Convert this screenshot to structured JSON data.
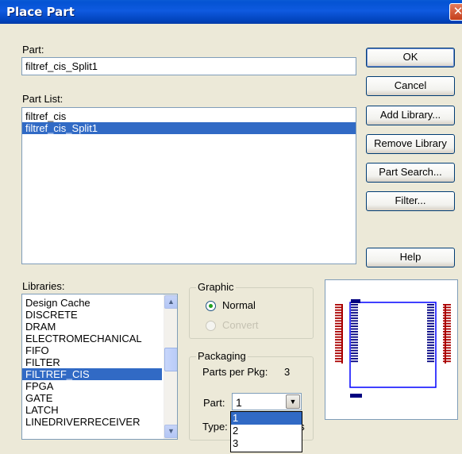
{
  "window": {
    "title": "Place Part",
    "close_glyph": "✕"
  },
  "part": {
    "label": "Part:",
    "value": "filtref_cis_Split1"
  },
  "part_list": {
    "label": "Part List:",
    "items": [
      "filtref_cis",
      "filtref_cis_Split1"
    ],
    "selected_index": 1
  },
  "buttons": {
    "ok": "OK",
    "cancel": "Cancel",
    "add_library": "Add Library...",
    "remove_library": "Remove Library",
    "part_search": "Part Search...",
    "filter": "Filter...",
    "help": "Help"
  },
  "libraries": {
    "label": "Libraries:",
    "items": [
      "Design Cache",
      "DISCRETE",
      "DRAM",
      "ELECTROMECHANICAL",
      "FIFO",
      "FILTER",
      "FILTREF_CIS",
      "FPGA",
      "GATE",
      "LATCH",
      "LINEDRIVERRECEIVER"
    ],
    "selected_index": 6
  },
  "graphic": {
    "title": "Graphic",
    "normal": "Normal",
    "convert": "Convert"
  },
  "packaging": {
    "title": "Packaging",
    "parts_per_pkg_label": "Parts per Pkg:",
    "parts_per_pkg_value": "3",
    "part_label": "Part:",
    "part_value": "1",
    "part_options": [
      "1",
      "2",
      "3"
    ],
    "type_label": "Type:",
    "type_value_fragment": "us"
  },
  "colors": {
    "selection": "#316ac5",
    "body_outline": "#0000ff",
    "pin_red": "#aa0000",
    "pin_body": "#000080"
  }
}
